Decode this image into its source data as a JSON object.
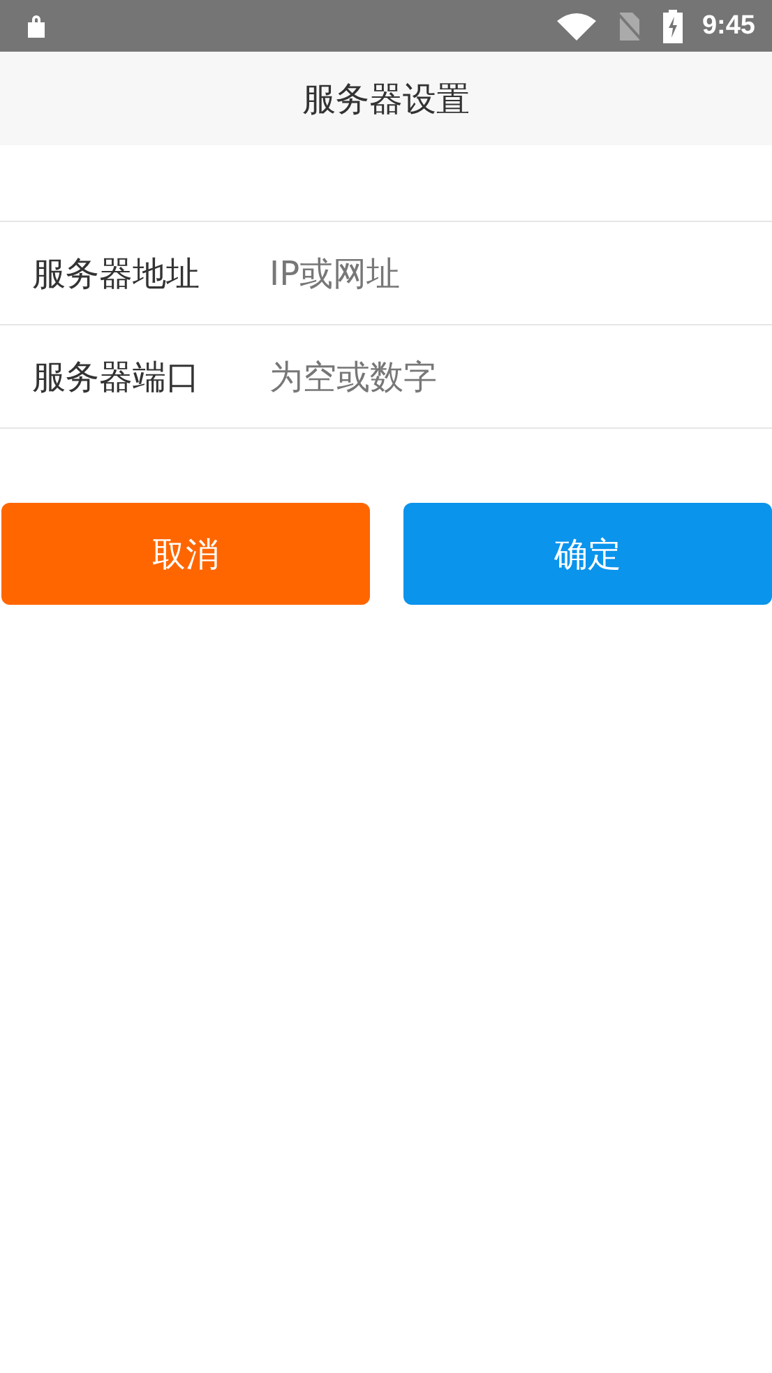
{
  "status_bar": {
    "time": "9:45"
  },
  "header": {
    "title": "服务器设置"
  },
  "fields": [
    {
      "label": "服务器地址",
      "placeholder": "IP或网址"
    },
    {
      "label": "服务器端口",
      "placeholder": "为空或数字"
    }
  ],
  "buttons": [
    {
      "label": "取消",
      "color": "#ff6600"
    },
    {
      "label": "确定",
      "color": "#0a94ec"
    }
  ]
}
